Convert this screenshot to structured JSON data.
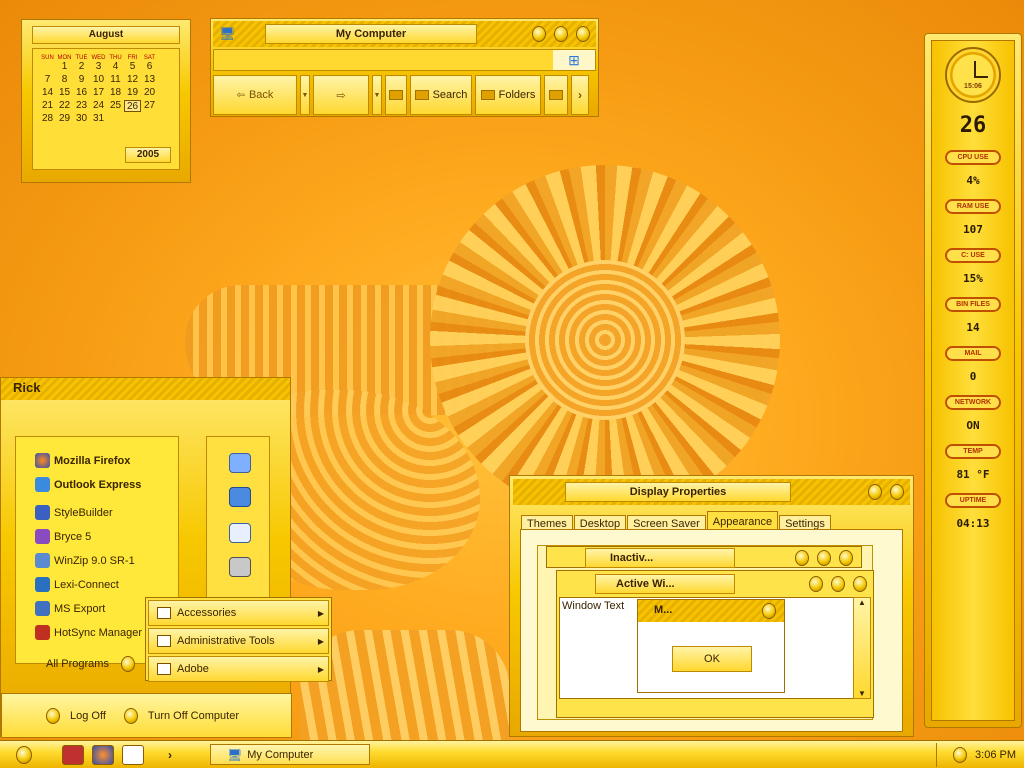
{
  "calendar": {
    "month": "August",
    "dow": [
      "SUN",
      "MON",
      "TUE",
      "WED",
      "THU",
      "FRI",
      "SAT"
    ],
    "days": [
      "",
      "1",
      "2",
      "3",
      "4",
      "5",
      "6",
      "7",
      "8",
      "9",
      "10",
      "11",
      "12",
      "13",
      "14",
      "15",
      "16",
      "17",
      "18",
      "19",
      "20",
      "21",
      "22",
      "23",
      "24",
      "25",
      "26",
      "27",
      "28",
      "29",
      "30",
      "31"
    ],
    "today": "26",
    "year": "2005"
  },
  "mycomputer": {
    "title": "My Computer",
    "back_label": "Back",
    "search_label": "Search",
    "folders_label": "Folders"
  },
  "sidebar": {
    "clock_time": "15:06",
    "day": "26",
    "widgets": [
      {
        "label": "CPU USE",
        "value": "4%"
      },
      {
        "label": "RAM USE",
        "value": "107"
      },
      {
        "label": "C: USE",
        "value": "15%"
      },
      {
        "label": "BIN FILES",
        "value": "14"
      },
      {
        "label": "MAIL",
        "value": "0"
      },
      {
        "label": "NETWORK",
        "value": "ON"
      },
      {
        "label": "TEMP",
        "value": "81 °F"
      },
      {
        "label": "UPTIME",
        "value": "04:13"
      }
    ]
  },
  "startmenu": {
    "user": "Rick",
    "pinned": [
      "Mozilla Firefox",
      "Outlook Express"
    ],
    "recent": [
      "StyleBuilder",
      "Bryce 5",
      "WinZip 9.0 SR-1",
      "Lexi-Connect",
      "MS Export",
      "HotSync Manager"
    ],
    "all_programs": "All Programs",
    "log_off": "Log Off",
    "turn_off": "Turn Off Computer",
    "programs": [
      "Accessories",
      "Administrative Tools",
      "Adobe"
    ]
  },
  "display_properties": {
    "title": "Display Properties",
    "tabs": [
      "Themes",
      "Desktop",
      "Screen Saver",
      "Appearance",
      "Settings"
    ],
    "selected_tab": "Appearance",
    "preview": {
      "inactive_title": "Inactiv...",
      "active_title": "Active Wi...",
      "window_text": "Window Text",
      "msg_title": "M...",
      "ok_label": "OK"
    }
  },
  "taskbar": {
    "task_label": "My Computer",
    "time": "3:06 PM"
  },
  "colors": {
    "accent": "#f7c800",
    "desktop": "#f59a12",
    "alert_red": "#b00000"
  }
}
